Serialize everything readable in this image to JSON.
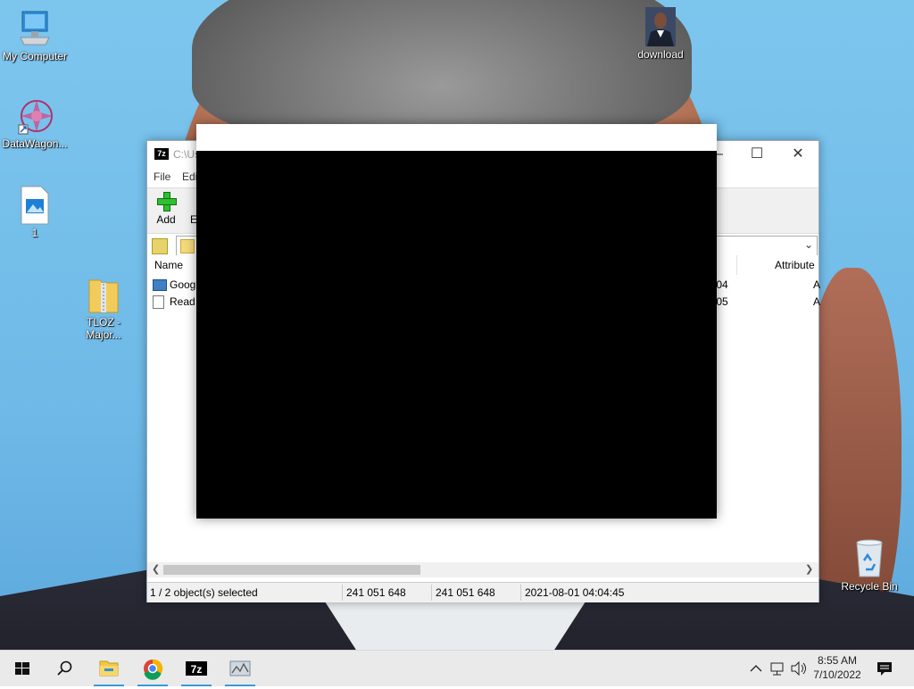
{
  "desktop": {
    "icons": [
      {
        "label": "My Computer"
      },
      {
        "label": "DataWagon..."
      },
      {
        "label": "1"
      },
      {
        "label": "TLOZ -\nMajor..."
      },
      {
        "label": "download"
      },
      {
        "label": "Recycle Bin"
      }
    ]
  },
  "window": {
    "title": "C:\\Us",
    "app_icon_text": "7z",
    "menu": [
      "File",
      "Edi"
    ],
    "toolbar": {
      "add_label": "Add",
      "extract_label": "Ex"
    },
    "columns": {
      "name": "Name",
      "attributes": "Attribute"
    },
    "rows": [
      {
        "name": "Googl",
        "modified_tail": ":04",
        "attr_tail": "A"
      },
      {
        "name": "Read M",
        "modified_tail": ":05",
        "attr_tail": "A"
      }
    ],
    "status": {
      "selection": "1 / 2 object(s) selected",
      "size": "241 051 648",
      "packed_size": "241 051 648",
      "modified": "2021-08-01 04:04:45"
    }
  },
  "taskbar": {
    "time": "8:55 AM",
    "date": "7/10/2022",
    "icons": [
      "windows-start-icon",
      "search-icon",
      "file-explorer-icon",
      "chrome-icon",
      "7zip-icon",
      "app-icon"
    ]
  }
}
